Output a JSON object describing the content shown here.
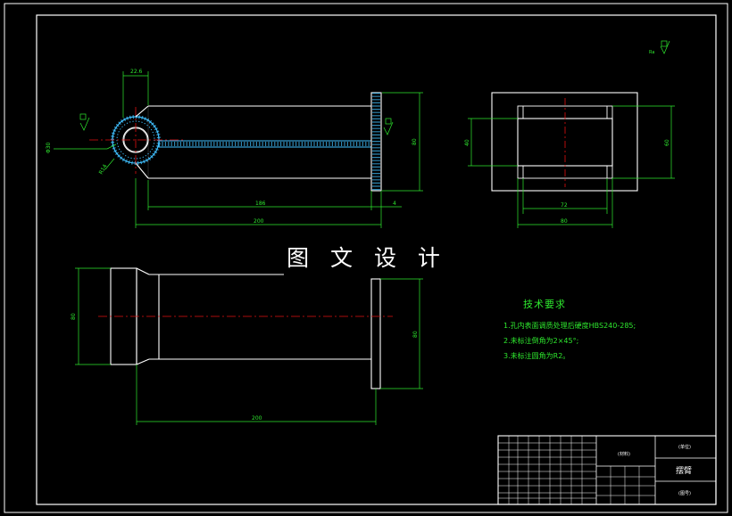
{
  "watermark": "图 文 设 计",
  "technical_requirements": {
    "title": "技术要求",
    "notes": [
      "1.孔内表面调质处理后硬度HBS240-285;",
      "2.未标注倒角为2×45°;",
      "3.未标注圆角为R2。"
    ]
  },
  "roughness_mark": "Ra",
  "dimensions": {
    "boss_width": "22.6",
    "length_186": "186",
    "length_200": "200",
    "flange_thickness": "4",
    "height_80": "80",
    "hole_diameter": "Φ30",
    "radius": "R14",
    "side_inner": "40",
    "side_outer": "60",
    "side_width_72": "72",
    "side_width_80": "80",
    "bottom_length": "200",
    "bottom_height_left": "80",
    "bottom_height_right": "80"
  },
  "title_block": {
    "material_label": "(材料)",
    "part_name": "摆臂",
    "drawing_label": "(图号)",
    "company_label": "(单位)"
  },
  "colors": {
    "outline": "#ffffff",
    "dimension": "#2ee82e",
    "centerline": "#e01010",
    "hatch": "#40c0ff",
    "background": "#000000"
  }
}
